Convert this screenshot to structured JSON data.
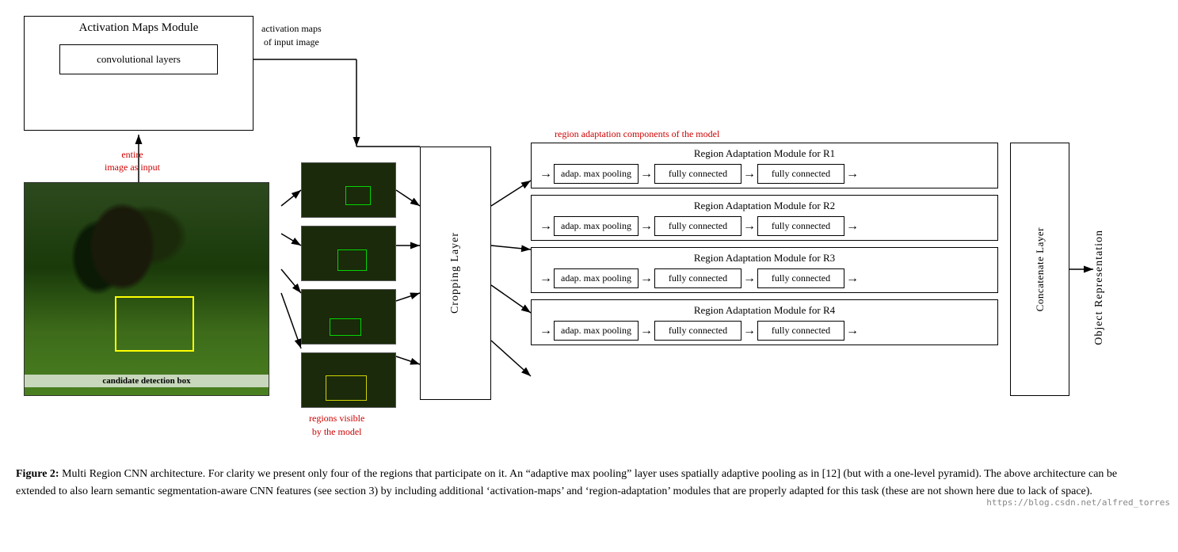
{
  "diagram": {
    "activation_module": {
      "title": "Activation Maps Module",
      "conv_layers": "convolutional layers"
    },
    "labels": {
      "entire_image": "entire\nimage as input",
      "activation_maps": "activation maps\nof input image",
      "regions_visible": "regions visible\nby the model",
      "region_adaptation_components": "region adaptation components of the model",
      "candidate_detection": "candidate\ndetection box",
      "cropping_layer": "Cropping Layer",
      "concatenate_layer": "Concatenate Layer",
      "object_representation": "Object Representation"
    },
    "ram_modules": [
      {
        "title": "Region Adaptation Module for R1",
        "box1": "adap. max pooling",
        "box2": "fully connected",
        "box3": "fully connected"
      },
      {
        "title": "Region Adaptation Module for R2",
        "box1": "adap. max pooling",
        "box2": "fully connected",
        "box3": "fully connected"
      },
      {
        "title": "Region Adaptation Module for R3",
        "box1": "adap. max pooling",
        "box2": "fully connected",
        "box3": "fully connected"
      },
      {
        "title": "Region Adaptation Module for R4",
        "box1": "adap. max pooling",
        "box2": "fully connected",
        "box3": "fully connected"
      }
    ]
  },
  "caption": {
    "bold_part": "Figure 2:",
    "text": " Multi Region CNN architecture. For clarity we present only four of the regions that participate on it. An “adaptive max pooling” layer uses spatially adaptive pooling as in [12] (but with a one-level pyramid). The above architecture can be extended to also learn semantic segmentation-aware CNN features (see section 3) by including additional ‘activation-maps’ and ‘region-adaptation’ modules that are properly adapted for this task (these are not shown here due to lack of space)."
  },
  "watermark": "https://blog.csdn.net/alfred_torres"
}
